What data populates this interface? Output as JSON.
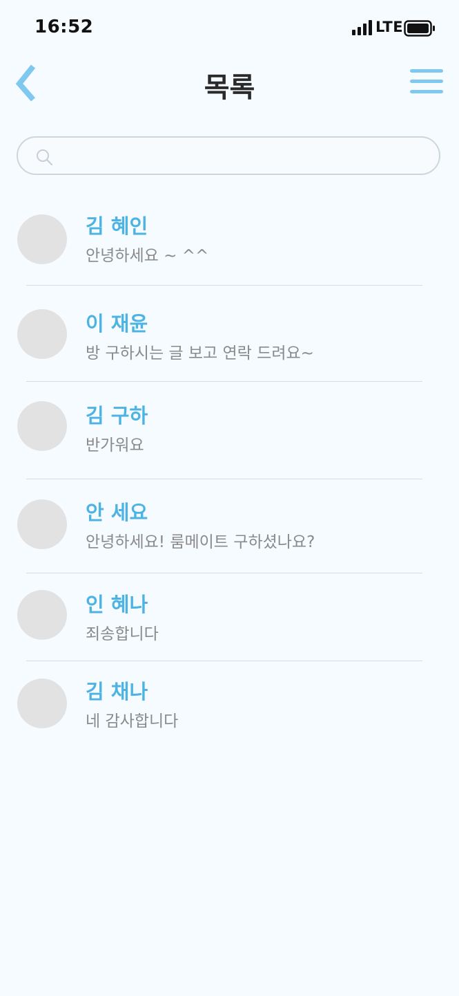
{
  "status_bar": {
    "time": "16:52",
    "network": "LTE"
  },
  "header": {
    "title": "목록",
    "back_icon": "chevron-left-icon",
    "menu_icon": "hamburger-menu-icon",
    "accent_color": "#7fc8f0"
  },
  "search": {
    "placeholder": "",
    "value": "",
    "icon": "search-icon"
  },
  "chats": [
    {
      "name": "김 혜인",
      "message": "안녕하세요 ~ ^^"
    },
    {
      "name": "이 재윤",
      "message": "방 구하시는 글 보고 연락 드려요~"
    },
    {
      "name": "김 구하",
      "message": "반가워요"
    },
    {
      "name": "안 세요",
      "message": "안녕하세요! 룸메이트 구하셨나요?"
    },
    {
      "name": "인 혜나",
      "message": "죄송합니다"
    },
    {
      "name": "김 채나",
      "message": "네 감사합니다"
    }
  ],
  "colors": {
    "background": "#f5fbff",
    "name": "#4db3e2",
    "message": "#8a8a8a",
    "avatar": "#e2e2e2"
  }
}
